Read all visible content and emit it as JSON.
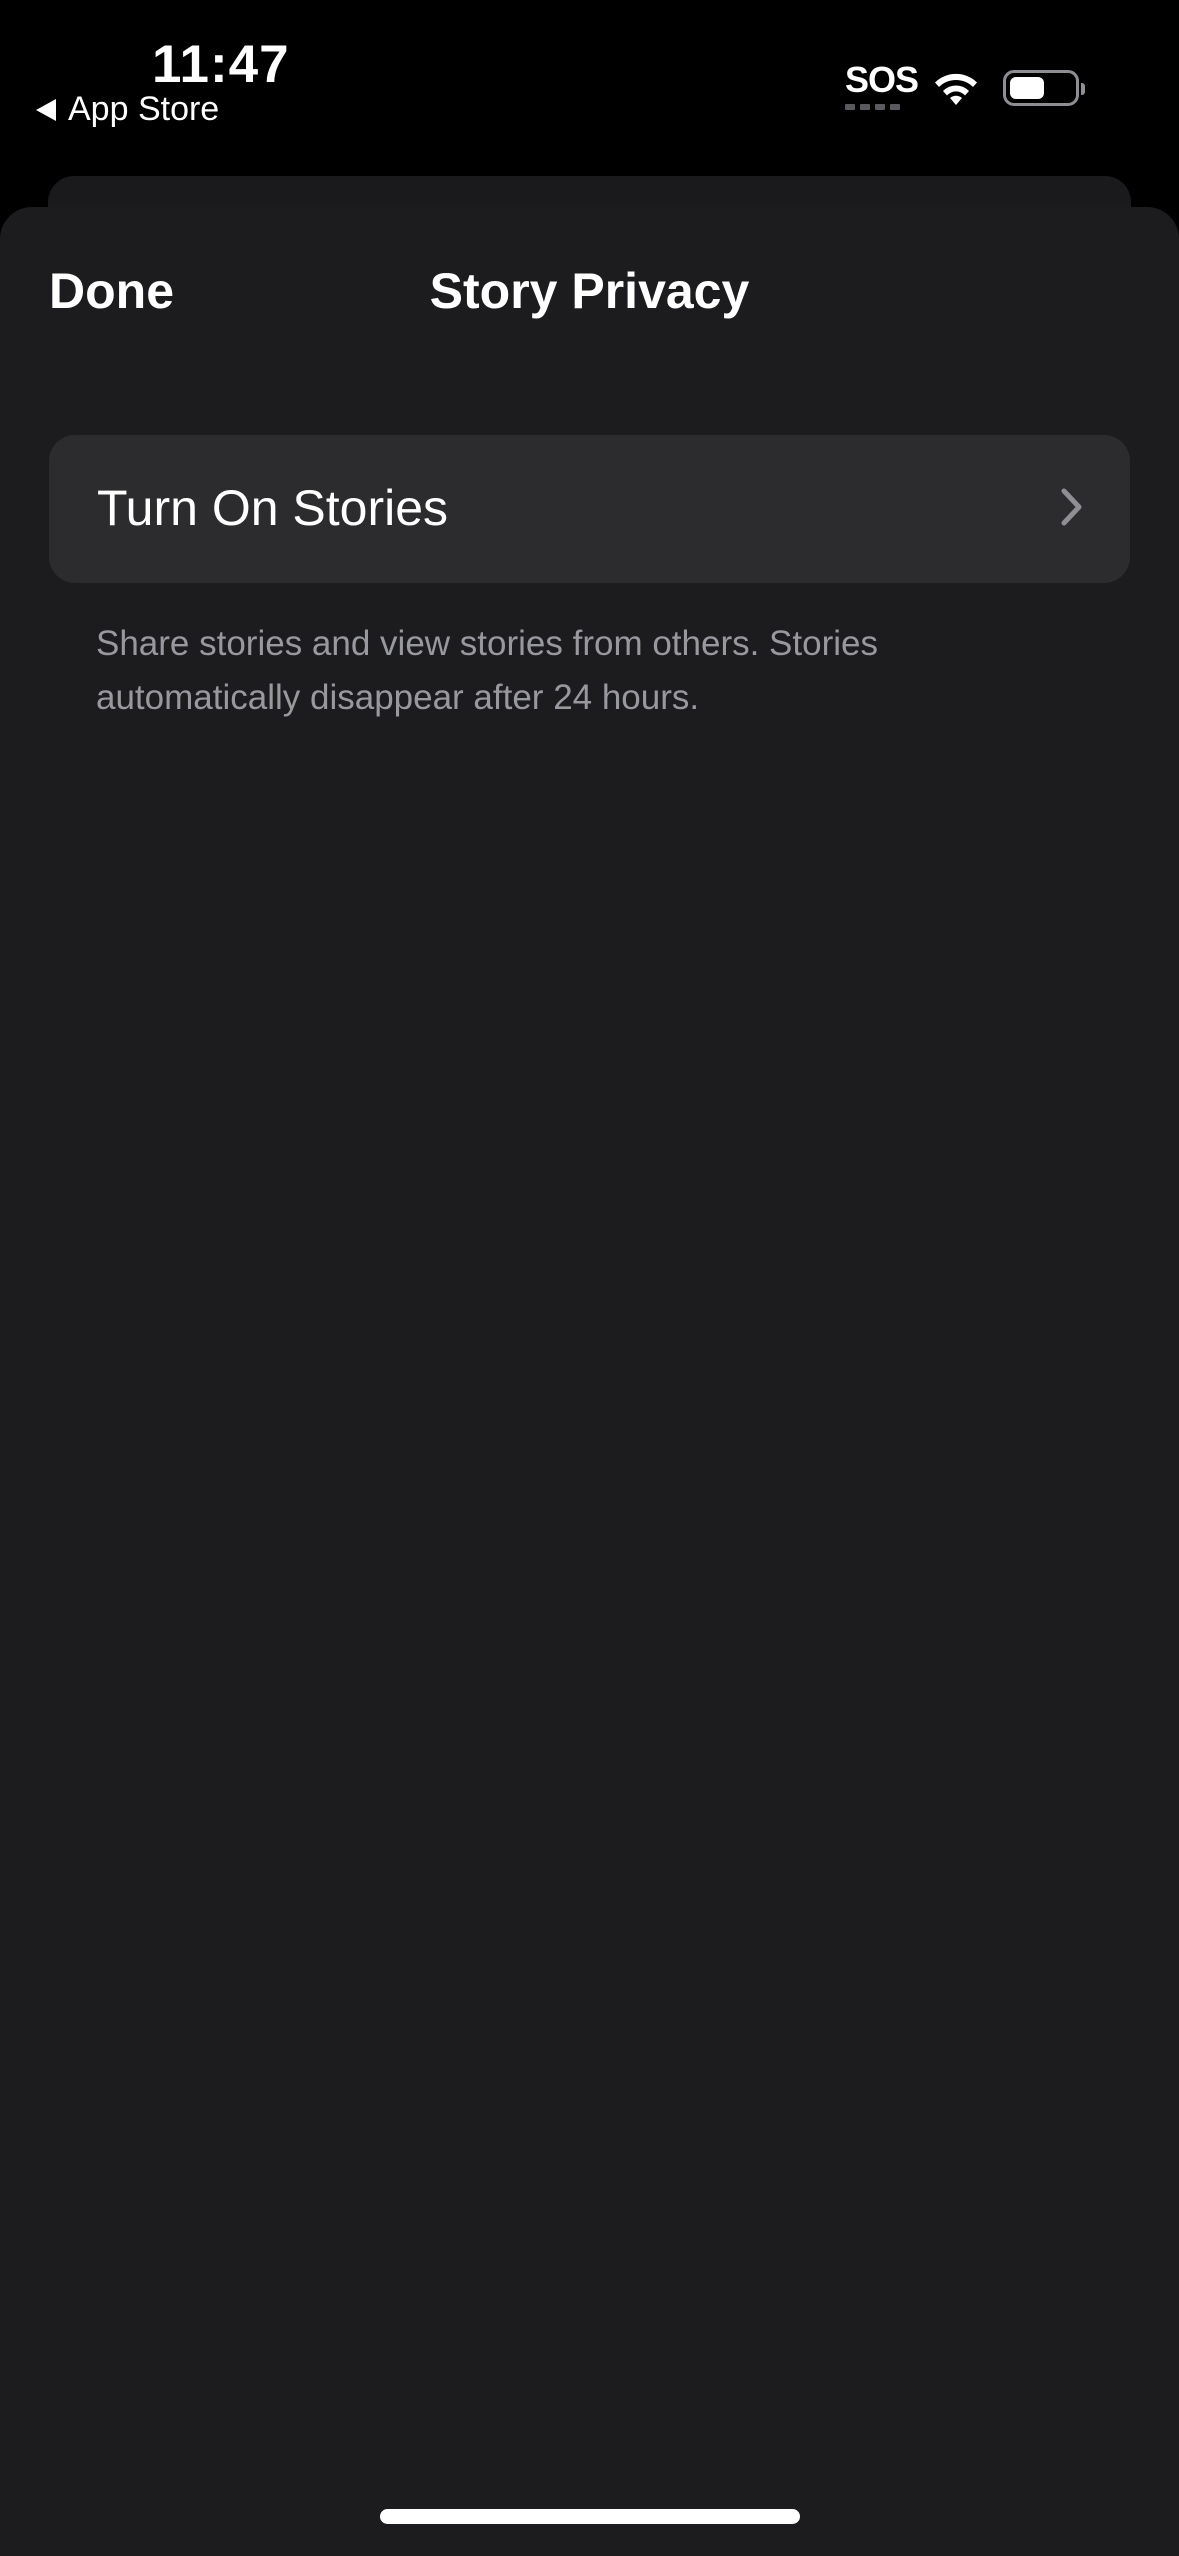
{
  "status_bar": {
    "time": "11:47",
    "back_app_label": "App Store",
    "sos_label": "SOS",
    "battery_level": 0.55
  },
  "nav": {
    "done_label": "Done",
    "title": "Story Privacy"
  },
  "settings": {
    "turn_on_stories_label": "Turn On Stories",
    "footer_note": "Share stories and view stories from others. Stories automatically disappear after 24 hours."
  },
  "icons": {
    "back": "back-triangle-icon",
    "chevron": "chevron-right-icon",
    "wifi": "wifi-icon",
    "battery": "battery-icon"
  },
  "colors": {
    "background": "#000000",
    "sheet": "#1c1c1e",
    "row": "#2c2c2e",
    "secondary_text": "#98989f"
  }
}
